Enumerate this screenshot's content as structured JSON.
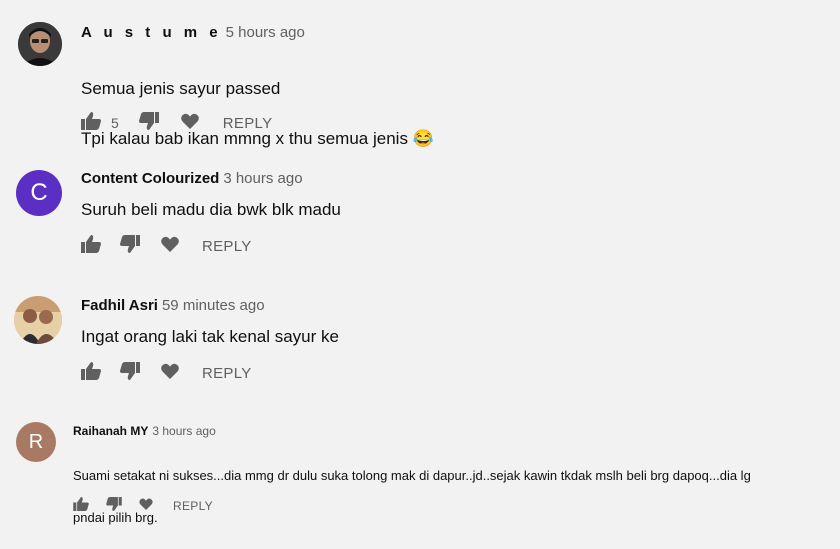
{
  "comments": [
    {
      "author": "A u s t u m e",
      "time": "5 hours ago",
      "avatar_letter": "",
      "avatar_color": "#2a2a2a",
      "text_line1": "Semua jenis sayur passed",
      "text_line2": "Tpi kalau bab ikan mmng x thu semua jenis 😂",
      "likes": "5",
      "reply_label": "REPLY"
    },
    {
      "author": "Content Colourized",
      "time": "3 hours ago",
      "avatar_letter": "C",
      "avatar_color": "#5b2fc3",
      "text_line1": "Suruh beli madu dia bwk blk madu",
      "likes": "",
      "reply_label": "REPLY"
    },
    {
      "author": "Fadhil Asri",
      "time": "59 minutes ago",
      "avatar_letter": "",
      "avatar_color": "#d9b48a",
      "text_line1": "Ingat orang laki tak kenal sayur ke",
      "likes": "",
      "reply_label": "REPLY"
    },
    {
      "author": "Raihanah MY",
      "time": "3 hours ago",
      "avatar_letter": "R",
      "avatar_color": "#a97a63",
      "text_line1": "Suami setakat ni sukses...dia mmg dr dulu suka tolong mak di dapur..jd..sejak kawin tkdak mslh beli brg dapoq...dia lg",
      "text_line2": "pndai pilih brg.",
      "likes": "",
      "reply_label": "REPLY"
    }
  ],
  "icons": {
    "like": "thumbs-up-icon",
    "dislike": "thumbs-down-icon",
    "heart": "heart-icon"
  },
  "colors": {
    "background": "#f2f2f2",
    "icon": "#606060",
    "secondary_text": "#606060"
  }
}
